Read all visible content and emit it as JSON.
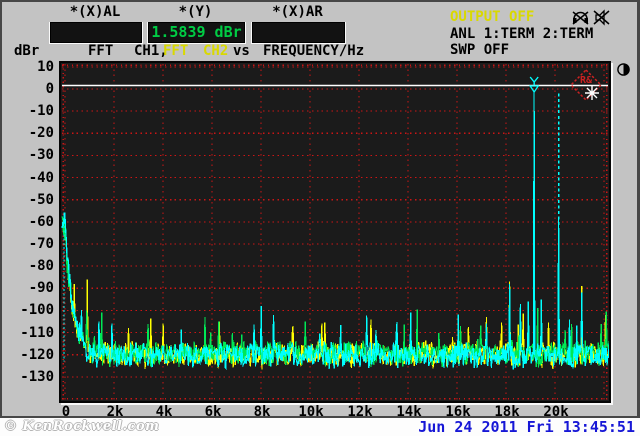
{
  "header": {
    "fields": [
      {
        "label": "*(X)AL",
        "value": ""
      },
      {
        "label": "*(Y)",
        "value": "1.5839 dBr"
      },
      {
        "label": "*(X)AR",
        "value": ""
      }
    ],
    "status": {
      "output": "OUTPUT OFF",
      "analyzer": "ANL 1:TERM 2:TERM",
      "sweep": "SWP OFF"
    },
    "trace_line": {
      "unit": "dBr",
      "ch1_fft": "FFT",
      "ch1": "CH1,",
      "ch2_fft": "FFT",
      "ch2": "CH2",
      "vs": "vs",
      "xlabel": "FREQUENCY/Hz"
    }
  },
  "footer": {
    "watermark": "© KenRockwell.com",
    "datetime": "Jun 24 2011 Fri 13:45:51"
  },
  "colors": {
    "background": "#c3c3c3",
    "plot_bg": "#1b1b1b",
    "grid_red": "#cc1515",
    "ch1_yellow": "#ffff00",
    "ch2_cyan": "#00ffff",
    "overlap_green": "#00e855",
    "value_green": "#00cc44",
    "status_yellow": "#d9d900",
    "date_blue": "#1717d6",
    "ref_line_white": "#ffffff",
    "logo_red": "#cc2222"
  },
  "chart_data": {
    "type": "line",
    "title": "FFT CH1, FFT CH2 vs FREQUENCY/Hz",
    "ylabel": "dBr",
    "xlabel": "FREQUENCY/Hz",
    "ylim": [
      -140,
      10
    ],
    "xlim_hz": [
      0,
      22200
    ],
    "grid": true,
    "yticks": [
      10,
      0,
      -10,
      -20,
      -30,
      -40,
      -50,
      -60,
      -70,
      -80,
      -90,
      -100,
      -110,
      -120,
      -130
    ],
    "xtick_khz": [
      0,
      2,
      4,
      6,
      8,
      10,
      12,
      14,
      16,
      18,
      20
    ],
    "xtick_labels": [
      "0",
      "2k",
      "4k",
      "6k",
      "8k",
      "10k",
      "12k",
      "14k",
      "16k",
      "18k",
      "20k"
    ],
    "grid_x_khz": [
      0,
      2,
      4,
      6,
      8,
      10,
      12,
      14,
      16,
      18,
      20,
      22
    ],
    "reference_line_dBr": 1.58,
    "cursor": {
      "marker_khz": 19.15,
      "marker_dBr": 0,
      "y_readout": "1.5839 dBr",
      "dashed_khz": 20.15,
      "dashed_top_dBr": -2,
      "dashed_bottom_dBr": -120,
      "left_dotted_khz": 0,
      "left_top_dBr": -60,
      "left_bottom_dBr": -123
    },
    "series": [
      {
        "name": "FFT CH1",
        "color": "#ffff00",
        "noise_floor_dBr": -120,
        "lf_rise_dBr": -63,
        "spikes_hz_dBr": [
          [
            370,
            -88
          ],
          [
            900,
            -86
          ],
          [
            2600,
            -108
          ],
          [
            4000,
            -106
          ],
          [
            6300,
            -105
          ],
          [
            9300,
            -107
          ],
          [
            10500,
            -106
          ],
          [
            12500,
            -104
          ],
          [
            16150,
            -108
          ],
          [
            17200,
            -103
          ],
          [
            18150,
            -87
          ],
          [
            19150,
            -97
          ],
          [
            21100,
            -89
          ]
        ]
      },
      {
        "name": "overlap",
        "color": "#00e855",
        "noise_floor_dBr": -119.5,
        "lf_rise_dBr": -64,
        "spikes_hz_dBr": [
          [
            1500,
            -101
          ],
          [
            5700,
            -103
          ],
          [
            9800,
            -105
          ],
          [
            16150,
            -107
          ],
          [
            19300,
            -99
          ]
        ]
      },
      {
        "name": "FFT CH2",
        "color": "#00ffff",
        "noise_floor_dBr": -120.5,
        "lf_rise_dBr": -60,
        "spikes_hz_dBr": [
          [
            1900,
            -106
          ],
          [
            8000,
            -98
          ],
          [
            14100,
            -101
          ],
          [
            17200,
            -106
          ],
          [
            18150,
            -88
          ],
          [
            18600,
            -97
          ],
          [
            18900,
            -96
          ],
          [
            19150,
            -1
          ],
          [
            19450,
            -95
          ],
          [
            20150,
            -58
          ],
          [
            20600,
            -104
          ],
          [
            21100,
            -92
          ]
        ]
      }
    ],
    "rs_logo_text": "R&"
  }
}
